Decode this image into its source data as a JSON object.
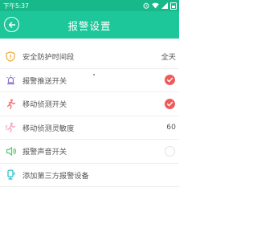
{
  "status": {
    "time": "下午5:37"
  },
  "header": {
    "title": "报警设置"
  },
  "settings": [
    {
      "label": "安全防护时间段",
      "value": "全天",
      "icon": "shield-icon",
      "color": "#f0a830"
    },
    {
      "label": "报警推送开关",
      "toggle": "on",
      "icon": "alarm-light-icon",
      "color": "#8a6fd6"
    },
    {
      "label": "移动侦测开关",
      "toggle": "on",
      "icon": "running-person-icon",
      "color": "#f26b6b"
    },
    {
      "label": "移动侦测灵敏度",
      "value": "60",
      "icon": "sensitivity-person-icon",
      "color": "#f2a3b8"
    },
    {
      "label": "报警声音开关",
      "toggle": "off",
      "icon": "speaker-icon",
      "color": "#5cc96a"
    },
    {
      "label": "添加第三方报警设备",
      "icon": "sensor-device-icon",
      "color": "#24b9c8"
    }
  ],
  "colors": {
    "status_bar": "#17b98a",
    "title_bar": "#1dc79a",
    "toggle_on": "#ef5a5a"
  }
}
